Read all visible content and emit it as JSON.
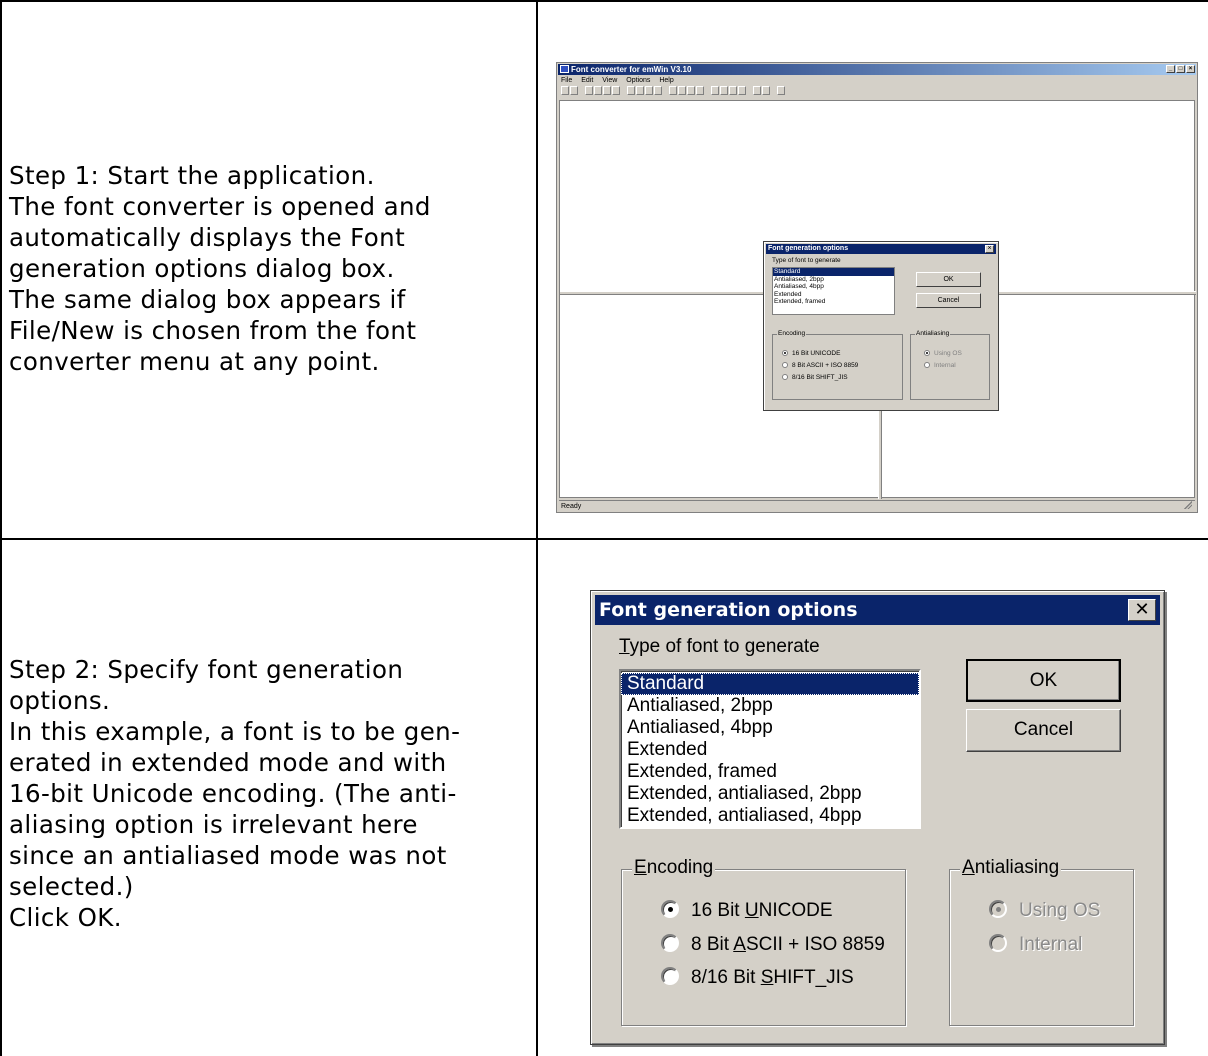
{
  "step1": {
    "lines": [
      "Step 1: Start the application.",
      "The font converter is opened and",
      "automatically displays the Font",
      "generation options dialog box.",
      "The same dialog box appears if",
      "File/New is chosen from the font",
      "converter menu at any point."
    ]
  },
  "step2": {
    "lines": [
      "Step 2: Specify font generation",
      "options.",
      "In this example, a font is to be gen-",
      "erated in extended mode and with",
      "16-bit Unicode encoding. (The anti-",
      "aliasing option is irrelevant here",
      "since an antialiased mode was not",
      "selected.)",
      "Click OK."
    ]
  },
  "app": {
    "title": "Font converter for emWin V3.10",
    "menu": [
      "File",
      "Edit",
      "View",
      "Options",
      "Help"
    ],
    "status": "Ready",
    "dialog": {
      "title": "Font generation options",
      "label": "Type of font to generate",
      "items": [
        "Standard",
        "Antialiased, 2bpp",
        "Antialiased, 4bpp",
        "Extended",
        "Extended, framed"
      ],
      "ok": "OK",
      "cancel": "Cancel",
      "encoding_label": "Encoding",
      "encoding_options": [
        "16 Bit UNICODE",
        "8 Bit ASCII + ISO 8859",
        "8/16 Bit SHIFT_JIS"
      ],
      "antialiasing_label": "Antialiasing",
      "antialiasing_options": [
        "Using OS",
        "Internal"
      ]
    }
  },
  "dialog": {
    "title": "Font generation options",
    "close": "✕",
    "label_u": "T",
    "label_rest": "ype of font to generate",
    "items": [
      "Standard",
      "Antialiased, 2bpp",
      "Antialiased, 4bpp",
      "Extended",
      "Extended, framed",
      "Extended, antialiased, 2bpp",
      "Extended, antialiased, 4bpp"
    ],
    "selected_index": 0,
    "ok": "OK",
    "cancel": "Cancel",
    "encoding": {
      "label_u": "E",
      "label_rest": "ncoding",
      "options": [
        {
          "pre": "16 Bit ",
          "u": "U",
          "post": "NICODE",
          "checked": true
        },
        {
          "pre": "8 Bit ",
          "u": "A",
          "post": "SCII + ISO 8859",
          "checked": false
        },
        {
          "pre": "8/16 Bit ",
          "u": "S",
          "post": "HIFT_JIS",
          "checked": false
        }
      ]
    },
    "antialiasing": {
      "label_u": "A",
      "label_rest": "ntialiasing",
      "options": [
        {
          "text": "Using OS",
          "checked": true
        },
        {
          "text": "Internal",
          "checked": false
        }
      ]
    }
  }
}
